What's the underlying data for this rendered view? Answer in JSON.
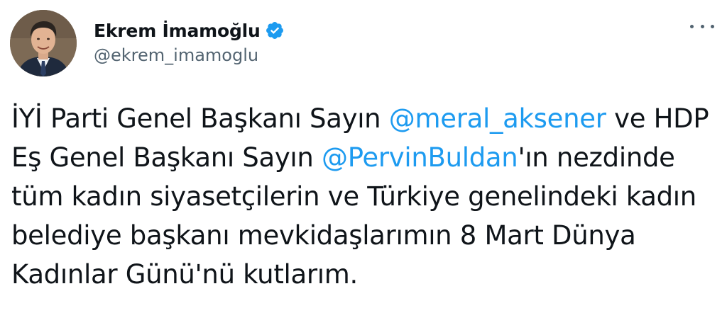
{
  "author": {
    "display_name": "Ekrem İmamoğlu",
    "handle": "@ekrem_imamoglu",
    "verified_icon": "verified-badge-icon",
    "avatar_icon": "profile-photo"
  },
  "more_icon": "more-options-icon",
  "colors": {
    "text": "#0f1419",
    "secondary": "#536471",
    "link": "#1d9bf0",
    "verified": "#1d9bf0"
  },
  "tweet": {
    "line1": {
      "pre": "İYİ Parti Genel Başkanı Sayın ",
      "mention": "@meral_aksener",
      "post": " ve HDP"
    },
    "line2": {
      "pre": "Eş Genel Başkanı Sayın ",
      "mention": "@PervinBuldan",
      "post": "'ın nezdinde"
    },
    "line3": "tüm kadın siyasetçilerin ve Türkiye genelindeki kadın",
    "line4": "belediye başkanı mevkidaşlarımın 8 Mart Dünya",
    "line5": "Kadınlar Günü'nü kutlarım."
  }
}
